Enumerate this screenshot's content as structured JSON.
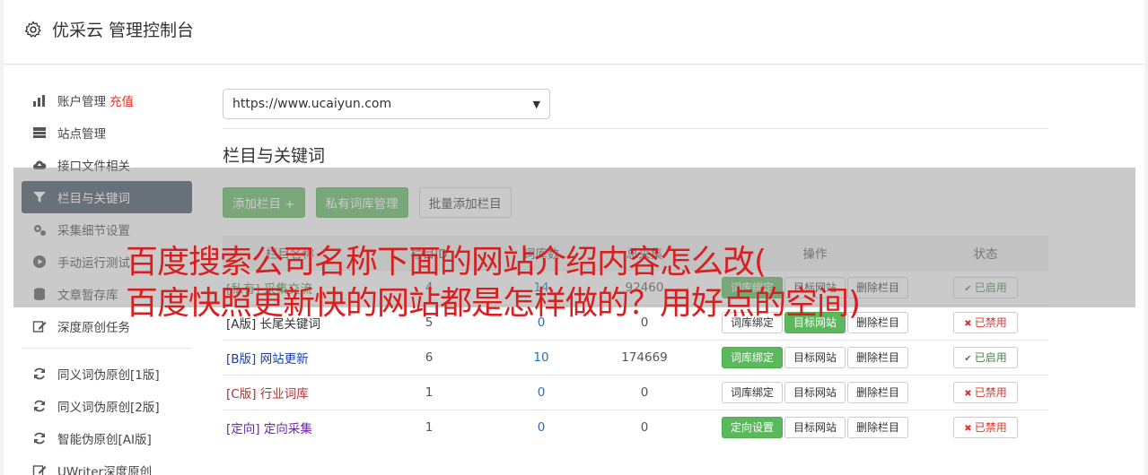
{
  "header": {
    "title": "优采云 管理控制台",
    "icon": "gear-icon"
  },
  "sidebar": {
    "items": [
      {
        "label": "账户管理",
        "extra": "充值",
        "icon": "bar-chart-icon",
        "active": false
      },
      {
        "label": "站点管理",
        "icon": "server-icon",
        "active": false
      },
      {
        "label": "接口文件相关",
        "icon": "cloud-upload-icon",
        "active": false
      },
      {
        "label": "栏目与关键词",
        "icon": "filter-icon",
        "active": true
      },
      {
        "label": "采集细节设置",
        "icon": "cogs-icon",
        "active": false
      },
      {
        "label": "手动运行测试",
        "icon": "play-icon",
        "active": false
      },
      {
        "label": "文章暂存库",
        "icon": "database-icon",
        "active": false
      },
      {
        "label": "深度原创任务",
        "icon": "edit-icon",
        "active": false
      }
    ],
    "items2": [
      {
        "label": "同义词伪原创[1版]",
        "icon": "refresh-icon"
      },
      {
        "label": "同义词伪原创[2版]",
        "icon": "refresh-icon"
      },
      {
        "label": "智能伪原创[AI版]",
        "icon": "refresh-icon"
      },
      {
        "label": "UWriter深度原创",
        "icon": "edit-icon"
      }
    ]
  },
  "main": {
    "site_select": "https://www.ucaiyun.com",
    "section_title": "栏目与关键词",
    "buttons": {
      "add": "添加栏目 +",
      "private_lib": "私有词库管理",
      "batch_add": "批量添加栏目"
    },
    "table": {
      "headers": [
        "栏目名称",
        "栏目ID",
        "词库数",
        "总采集",
        "操作",
        "状态"
      ],
      "rows": [
        {
          "tag": "[私有]",
          "name": "采集交流",
          "cls": "n-private",
          "id": "4",
          "count": "14",
          "total": "92460",
          "op1": "词库绑定",
          "op1_green": true,
          "op2": "目标网站",
          "op2_green": false,
          "op3": "删除栏目",
          "status": "已启用",
          "on": true
        },
        {
          "tag": "[A版]",
          "name": "长尾关键词",
          "cls": "n-a",
          "id": "5",
          "count": "0",
          "total": "0",
          "op1": "词库绑定",
          "op1_green": false,
          "op2": "目标网站",
          "op2_green": true,
          "op3": "删除栏目",
          "status": "已禁用",
          "on": false
        },
        {
          "tag": "[B版]",
          "name": "网站更新",
          "cls": "n-b",
          "id": "6",
          "count": "10",
          "total": "174669",
          "op1": "词库绑定",
          "op1_green": true,
          "op2": "目标网站",
          "op2_green": false,
          "op3": "删除栏目",
          "status": "已启用",
          "on": true
        },
        {
          "tag": "[C版]",
          "name": "行业词库",
          "cls": "n-c",
          "id": "1",
          "count": "0",
          "total": "0",
          "op1": "词库绑定",
          "op1_green": false,
          "op2": "目标网站",
          "op2_green": false,
          "op3": "删除栏目",
          "status": "已禁用",
          "on": false
        },
        {
          "tag": "[定向]",
          "name": "定向采集",
          "cls": "n-d",
          "id": "1",
          "count": "0",
          "total": "0",
          "op1": "定向设置",
          "op1_green": true,
          "op2": "目标网站",
          "op2_green": false,
          "op3": "删除栏目",
          "status": "已禁用",
          "on": false
        }
      ]
    }
  },
  "overlay_text": {
    "line1": "百度搜索公司名称下面的网站介绍内容怎么改(",
    "line2": "百度快照更新快的网站都是怎样做的？用好点的空间)"
  },
  "colors": {
    "accent_green": "#5cb85c",
    "sidebar_active": "#3a4a5c",
    "ad_red": "#d81e1e"
  }
}
